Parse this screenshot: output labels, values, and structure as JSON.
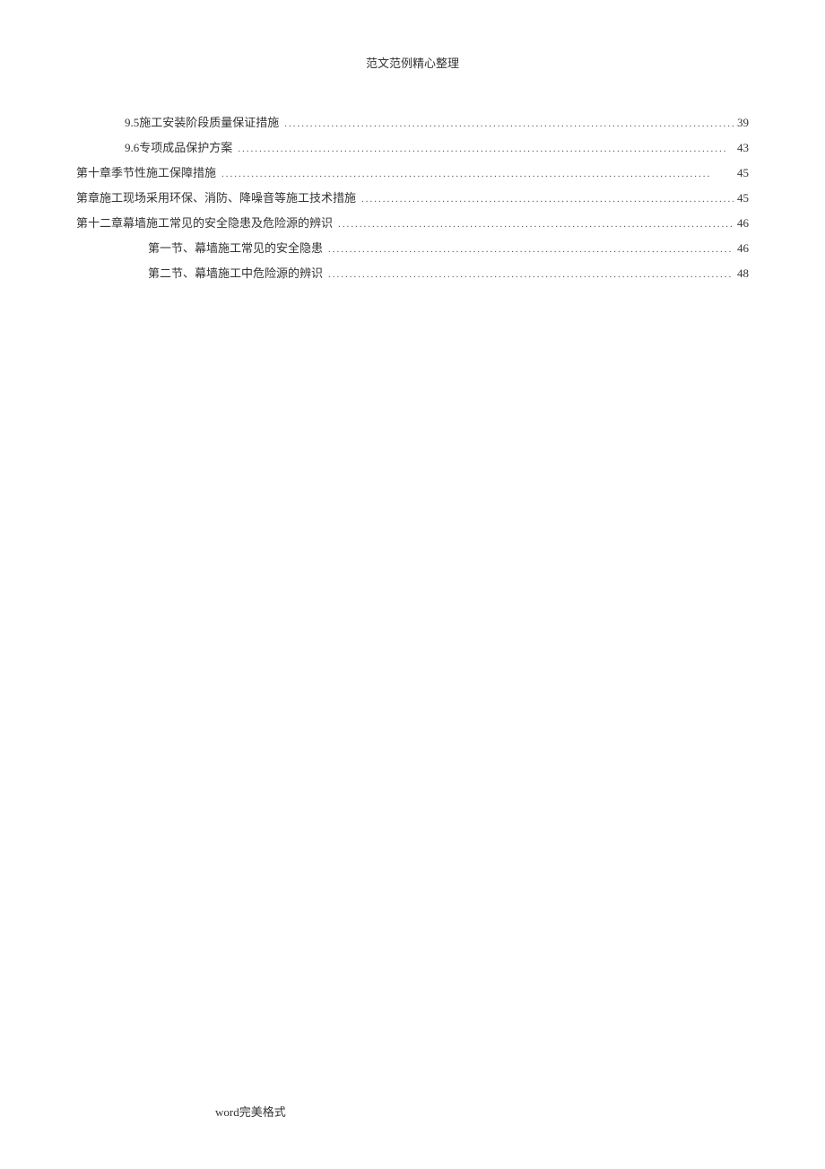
{
  "header": {
    "title": "范文范例精心整理"
  },
  "toc": {
    "entries": [
      {
        "indent": 1,
        "title": "9.5施工安装阶段质量保证措施",
        "page": "39"
      },
      {
        "indent": 1,
        "title": "9.6专项成品保护方案",
        "page": "43"
      },
      {
        "indent": 0,
        "title": "第十章季节性施工保障措施",
        "page": "45"
      },
      {
        "indent": 0,
        "title": "第章施工现场采用环保、消防、降噪音等施工技术措施",
        "page": "45"
      },
      {
        "indent": 0,
        "title": "第十二章幕墙施工常见的安全隐患及危险源的辨识",
        "page": "46"
      },
      {
        "indent": 2,
        "title": "第一节、幕墙施工常见的安全隐患",
        "page": "46"
      },
      {
        "indent": 2,
        "title": "第二节、幕墙施工中危险源的辨识",
        "page": "48"
      }
    ]
  },
  "footer": {
    "text": "word完美格式"
  }
}
